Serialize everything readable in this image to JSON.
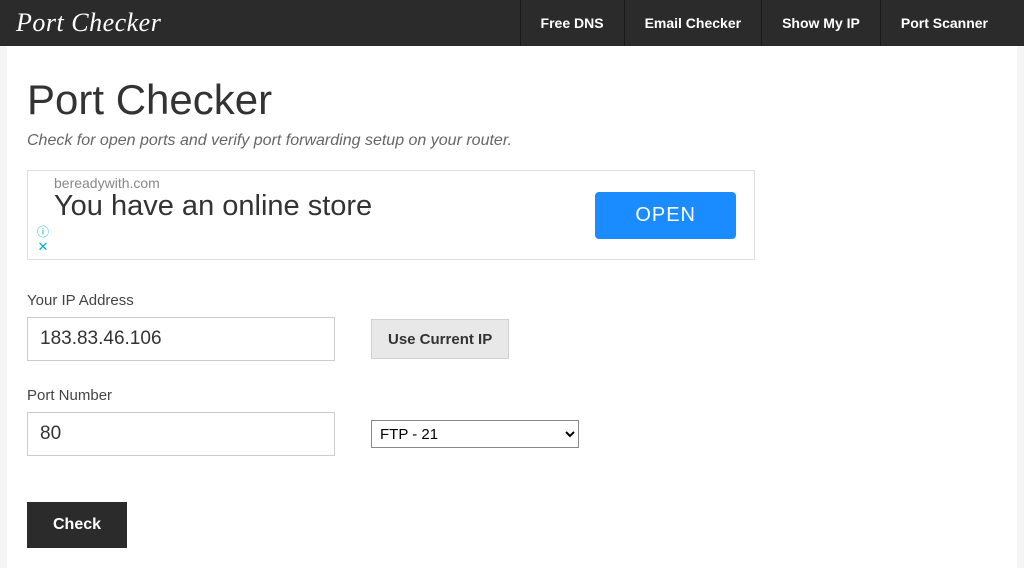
{
  "header": {
    "logo": "Port Checker",
    "nav": [
      "Free DNS",
      "Email Checker",
      "Show My IP",
      "Port Scanner"
    ]
  },
  "page": {
    "title": "Port Checker",
    "subtitle": "Check for open ports and verify port forwarding setup on your router."
  },
  "ad": {
    "domain": "bereadywith.com",
    "headline": "You have an online store",
    "cta": "OPEN"
  },
  "form": {
    "ip_label": "Your IP Address",
    "ip_value": "183.83.46.106",
    "use_current_ip": "Use Current IP",
    "port_label": "Port Number",
    "port_value": "80",
    "port_select_value": "FTP - 21",
    "check_button": "Check"
  }
}
